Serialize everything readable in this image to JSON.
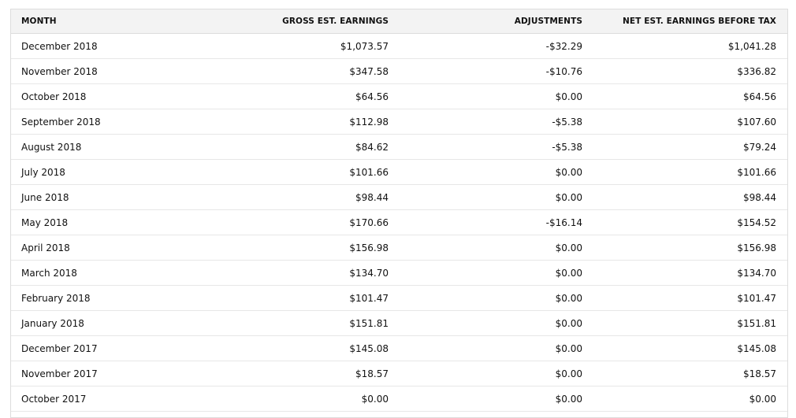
{
  "table": {
    "headers": {
      "month": "MONTH",
      "gross": "GROSS EST. EARNINGS",
      "adjustments": "ADJUSTMENTS",
      "net": "NET EST. EARNINGS BEFORE TAX"
    },
    "rows": [
      {
        "month": "December 2018",
        "gross": "$1,073.57",
        "adjustments": "-$32.29",
        "net": "$1,041.28"
      },
      {
        "month": "November 2018",
        "gross": "$347.58",
        "adjustments": "-$10.76",
        "net": "$336.82"
      },
      {
        "month": "October 2018",
        "gross": "$64.56",
        "adjustments": "$0.00",
        "net": "$64.56"
      },
      {
        "month": "September 2018",
        "gross": "$112.98",
        "adjustments": "-$5.38",
        "net": "$107.60"
      },
      {
        "month": "August 2018",
        "gross": "$84.62",
        "adjustments": "-$5.38",
        "net": "$79.24"
      },
      {
        "month": "July 2018",
        "gross": "$101.66",
        "adjustments": "$0.00",
        "net": "$101.66"
      },
      {
        "month": "June 2018",
        "gross": "$98.44",
        "adjustments": "$0.00",
        "net": "$98.44"
      },
      {
        "month": "May 2018",
        "gross": "$170.66",
        "adjustments": "-$16.14",
        "net": "$154.52"
      },
      {
        "month": "April 2018",
        "gross": "$156.98",
        "adjustments": "$0.00",
        "net": "$156.98"
      },
      {
        "month": "March 2018",
        "gross": "$134.70",
        "adjustments": "$0.00",
        "net": "$134.70"
      },
      {
        "month": "February 2018",
        "gross": "$101.47",
        "adjustments": "$0.00",
        "net": "$101.47"
      },
      {
        "month": "January 2018",
        "gross": "$151.81",
        "adjustments": "$0.00",
        "net": "$151.81"
      },
      {
        "month": "December 2017",
        "gross": "$145.08",
        "adjustments": "$0.00",
        "net": "$145.08"
      },
      {
        "month": "November 2017",
        "gross": "$18.57",
        "adjustments": "$0.00",
        "net": "$18.57"
      },
      {
        "month": "October 2017",
        "gross": "$0.00",
        "adjustments": "$0.00",
        "net": "$0.00"
      }
    ]
  },
  "colors": {
    "header_background": "#f3f3f3",
    "border": "#dddddd",
    "text": "#111111"
  }
}
